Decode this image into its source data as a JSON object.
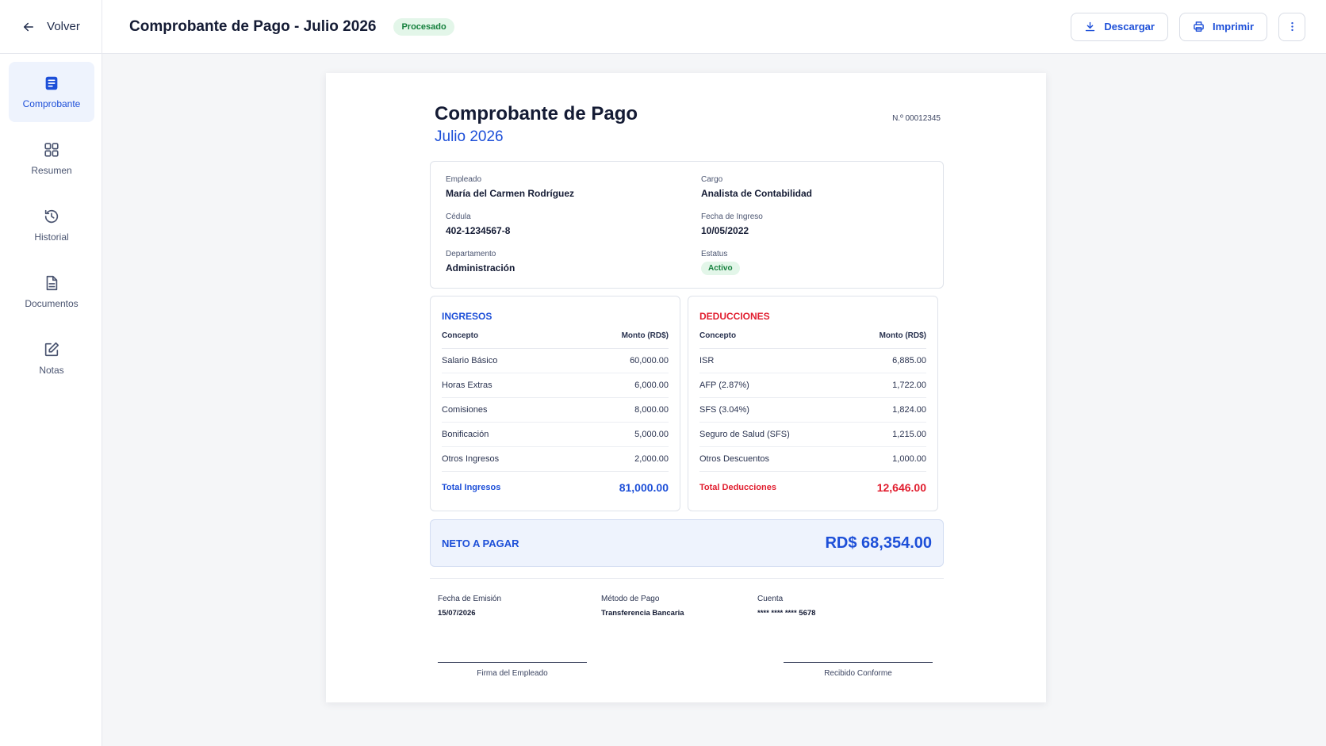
{
  "header": {
    "back_label": "Volver",
    "title": "Comprobante de Pago - Julio 2026",
    "status": "Procesado",
    "download_label": "Descargar",
    "print_label": "Imprimir"
  },
  "sidebar": {
    "items": [
      {
        "label": "Comprobante",
        "icon": "receipt-icon",
        "active": true
      },
      {
        "label": "Resumen",
        "icon": "grid-icon",
        "active": false
      },
      {
        "label": "Historial",
        "icon": "history-icon",
        "active": false
      },
      {
        "label": "Documentos",
        "icon": "document-icon",
        "active": false
      },
      {
        "label": "Notas",
        "icon": "edit-icon",
        "active": false
      }
    ]
  },
  "document": {
    "title": "Comprobante de Pago",
    "period": "Julio 2026",
    "number": "N.º 00012345",
    "employee": {
      "name_label": "Empleado",
      "name": "María del Carmen Rodríguez",
      "position_label": "Cargo",
      "position": "Analista de Contabilidad",
      "id_label": "Cédula",
      "id": "402-1234567-8",
      "hire_label": "Fecha de Ingreso",
      "hire_date": "10/05/2022",
      "dept_label": "Departamento",
      "dept": "Administración",
      "status_label": "Estatus",
      "status": "Activo"
    },
    "income": {
      "title": "INGRESOS",
      "col_concept": "Concepto",
      "col_amount": "Monto (RD$)",
      "rows": [
        {
          "concept": "Salario Básico",
          "amount": "60,000.00"
        },
        {
          "concept": "Horas Extras",
          "amount": "6,000.00"
        },
        {
          "concept": "Comisiones",
          "amount": "8,000.00"
        },
        {
          "concept": "Bonificación",
          "amount": "5,000.00"
        },
        {
          "concept": "Otros Ingresos",
          "amount": "2,000.00"
        }
      ],
      "total_label": "Total Ingresos",
      "total": "81,000.00"
    },
    "deductions": {
      "title": "DEDUCCIONES",
      "col_concept": "Concepto",
      "col_amount": "Monto (RD$)",
      "rows": [
        {
          "concept": "ISR",
          "amount": "6,885.00"
        },
        {
          "concept": "AFP (2.87%)",
          "amount": "1,722.00"
        },
        {
          "concept": "SFS (3.04%)",
          "amount": "1,824.00"
        },
        {
          "concept": "Seguro de Salud (SFS)",
          "amount": "1,215.00"
        },
        {
          "concept": "Otros Descuentos",
          "amount": "1,000.00"
        }
      ],
      "total_label": "Total Deducciones",
      "total": "12,646.00"
    },
    "net": {
      "label": "NETO A PAGAR",
      "value": "RD$ 68,354.00"
    },
    "meta": {
      "issue_label": "Fecha de Emisión",
      "issue_date": "15/07/2026",
      "method_label": "Método de Pago",
      "method": "Transferencia Bancaria",
      "account_label": "Cuenta",
      "account": "**** **** **** 5678"
    },
    "signatures": {
      "employee": "Firma del Empleado",
      "received": "Recibido Conforme"
    }
  },
  "colors": {
    "accent": "#1d4fd8",
    "danger": "#e11d2e",
    "success": "#15803d"
  }
}
